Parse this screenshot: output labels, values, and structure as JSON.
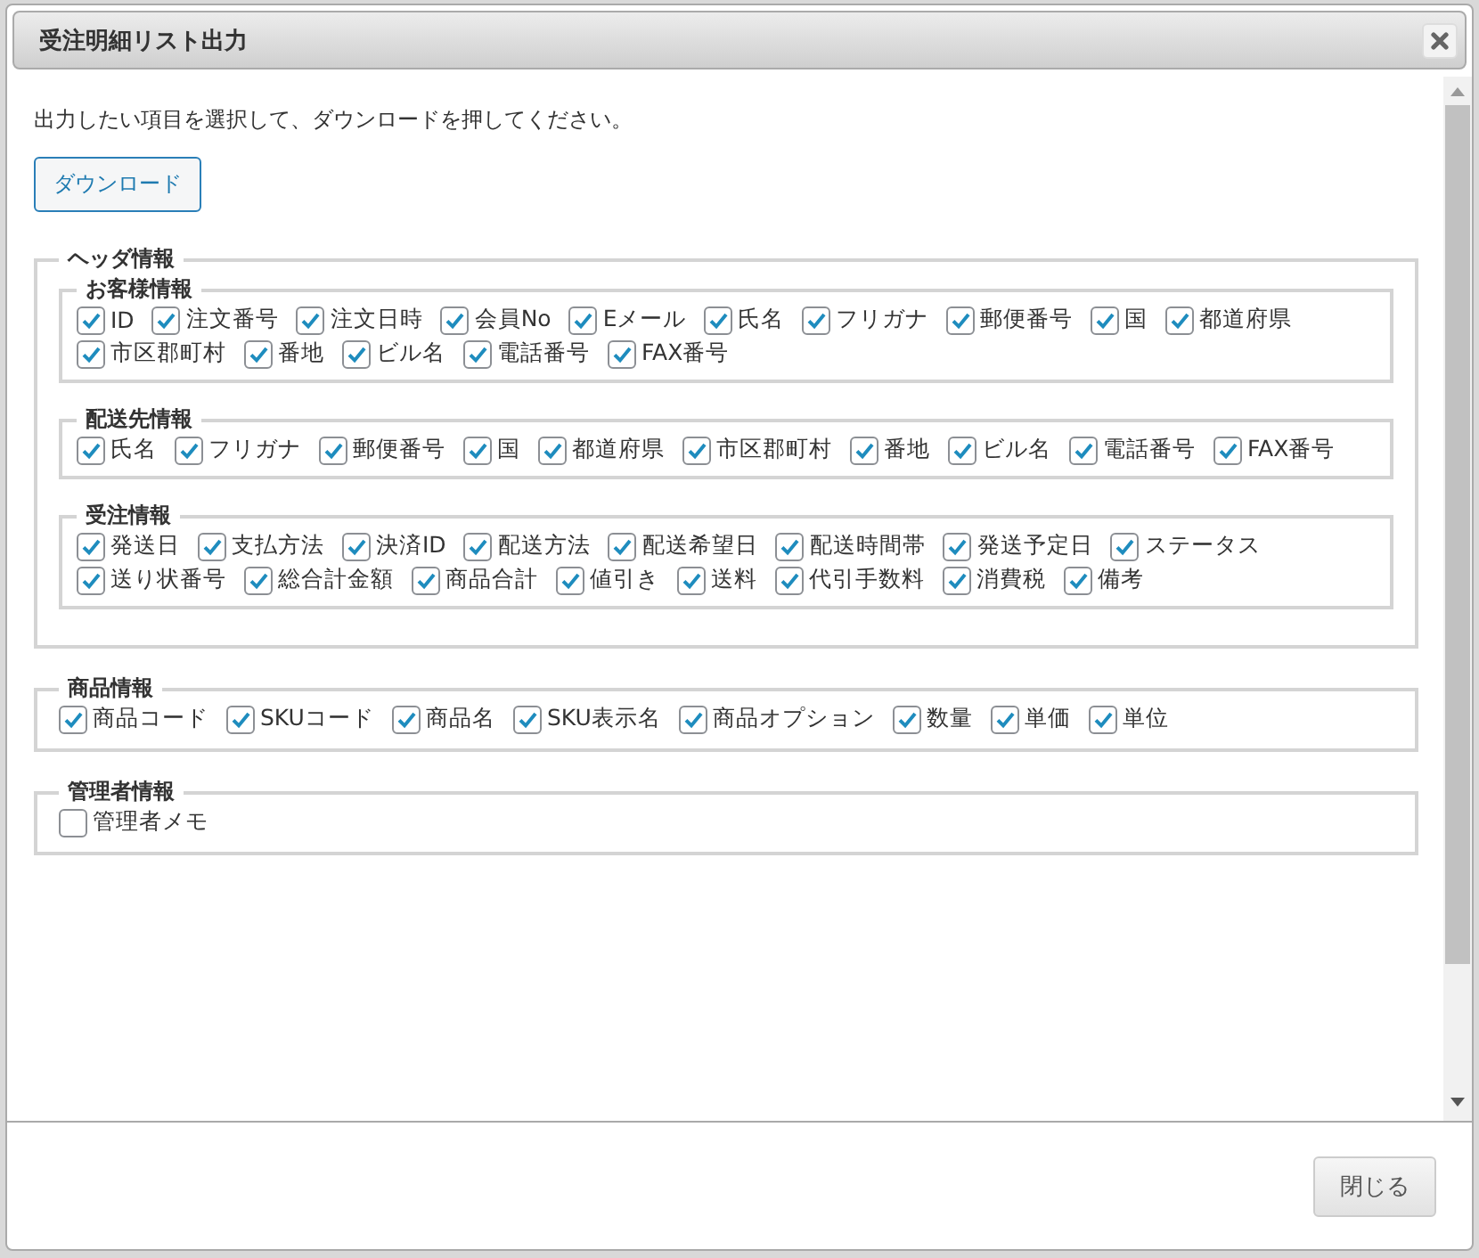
{
  "dialog": {
    "title": "受注明細リスト出力",
    "instruction": "出力したい項目を選択して、ダウンロードを押してください。",
    "download_button": "ダウンロード",
    "sections": [
      {
        "legend": "ヘッダ情報",
        "groups": [
          {
            "legend": "お客様情報",
            "options": [
              {
                "label": "ID",
                "checked": true
              },
              {
                "label": "注文番号",
                "checked": true
              },
              {
                "label": "注文日時",
                "checked": true
              },
              {
                "label": "会員No",
                "checked": true
              },
              {
                "label": "Eメール",
                "checked": true
              },
              {
                "label": "氏名",
                "checked": true
              },
              {
                "label": "フリガナ",
                "checked": true
              },
              {
                "label": "郵便番号",
                "checked": true
              },
              {
                "label": "国",
                "checked": true
              },
              {
                "label": "都道府県",
                "checked": true
              },
              {
                "label": "市区郡町村",
                "checked": true
              },
              {
                "label": "番地",
                "checked": true
              },
              {
                "label": "ビル名",
                "checked": true
              },
              {
                "label": "電話番号",
                "checked": true
              },
              {
                "label": "FAX番号",
                "checked": true
              }
            ]
          },
          {
            "legend": "配送先情報",
            "options": [
              {
                "label": "氏名",
                "checked": true
              },
              {
                "label": "フリガナ",
                "checked": true
              },
              {
                "label": "郵便番号",
                "checked": true
              },
              {
                "label": "国",
                "checked": true
              },
              {
                "label": "都道府県",
                "checked": true
              },
              {
                "label": "市区郡町村",
                "checked": true
              },
              {
                "label": "番地",
                "checked": true
              },
              {
                "label": "ビル名",
                "checked": true
              },
              {
                "label": "電話番号",
                "checked": true
              },
              {
                "label": "FAX番号",
                "checked": true
              }
            ]
          },
          {
            "legend": "受注情報",
            "options": [
              {
                "label": "発送日",
                "checked": true
              },
              {
                "label": "支払方法",
                "checked": true
              },
              {
                "label": "決済ID",
                "checked": true
              },
              {
                "label": "配送方法",
                "checked": true
              },
              {
                "label": "配送希望日",
                "checked": true
              },
              {
                "label": "配送時間帯",
                "checked": true
              },
              {
                "label": "発送予定日",
                "checked": true
              },
              {
                "label": "ステータス",
                "checked": true
              },
              {
                "label": "送り状番号",
                "checked": true
              },
              {
                "label": "総合計金額",
                "checked": true
              },
              {
                "label": "商品合計",
                "checked": true
              },
              {
                "label": "値引き",
                "checked": true
              },
              {
                "label": "送料",
                "checked": true
              },
              {
                "label": "代引手数料",
                "checked": true
              },
              {
                "label": "消費税",
                "checked": true
              },
              {
                "label": "備考",
                "checked": true
              }
            ]
          }
        ]
      },
      {
        "legend": "商品情報",
        "options": [
          {
            "label": "商品コード",
            "checked": true
          },
          {
            "label": "SKUコード",
            "checked": true
          },
          {
            "label": "商品名",
            "checked": true
          },
          {
            "label": "SKU表示名",
            "checked": true
          },
          {
            "label": "商品オプション",
            "checked": true
          },
          {
            "label": "数量",
            "checked": true
          },
          {
            "label": "単価",
            "checked": true
          },
          {
            "label": "単位",
            "checked": true
          }
        ]
      },
      {
        "legend": "管理者情報",
        "options": [
          {
            "label": "管理者メモ",
            "checked": false
          }
        ]
      }
    ],
    "close_button": "閉じる"
  }
}
